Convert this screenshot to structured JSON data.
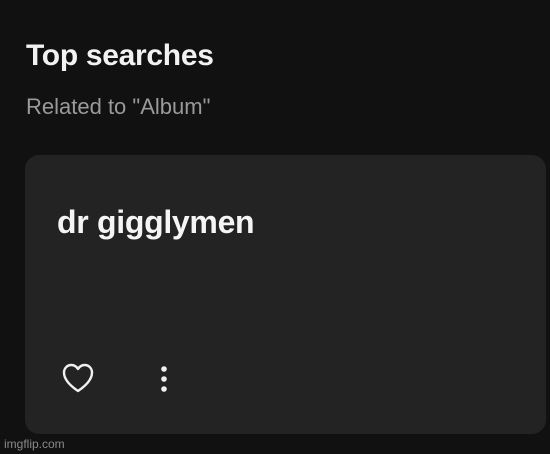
{
  "top_searches": {
    "title": "Top searches",
    "subtitle": "Related to \"Album\""
  },
  "card": {
    "title": "dr gigglymen",
    "actions": {
      "like_icon": "heart-outline-icon",
      "more_icon": "more-vertical-icon"
    }
  },
  "watermark": "imgflip.com",
  "colors": {
    "background": "#111111",
    "card_background": "#232323",
    "primary_text": "#f2f2f2",
    "secondary_text": "#9a9a9a",
    "icon": "#f0f0f0"
  }
}
